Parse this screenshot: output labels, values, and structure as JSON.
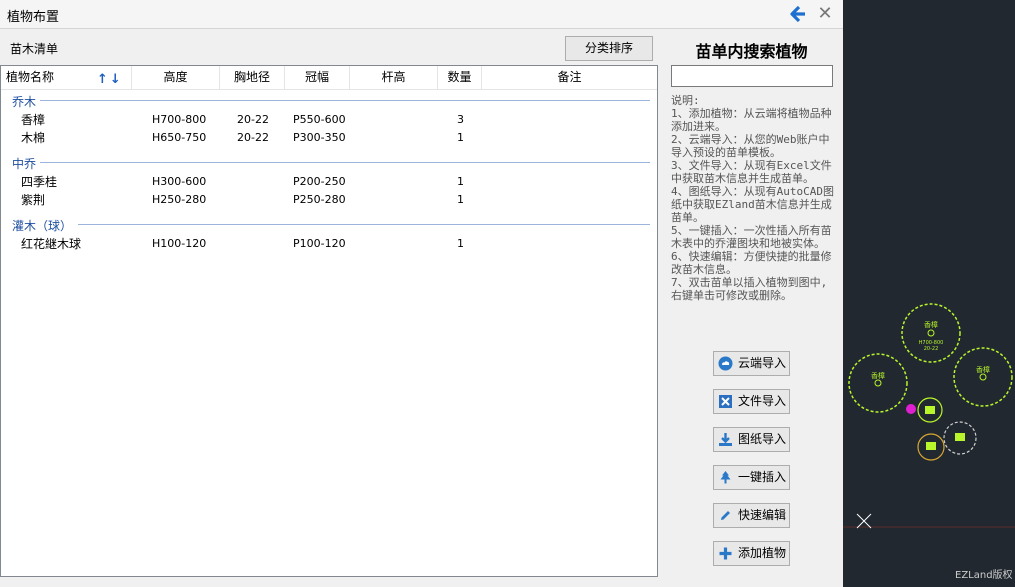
{
  "window": {
    "title": "植物布置"
  },
  "list_label": "苗木清单",
  "sort_button": "分类排序",
  "columns": [
    "植物名称",
    "高度",
    "胸地径",
    "冠幅",
    "杆高",
    "数量",
    "备注"
  ],
  "groups": [
    {
      "name": "乔木",
      "rows": [
        {
          "name": "香樟",
          "height": "H700-800",
          "dbh": "20-22",
          "crown": "P550-600",
          "pole": "",
          "qty": "3",
          "note": ""
        },
        {
          "name": "木棉",
          "height": "H650-750",
          "dbh": "20-22",
          "crown": "P300-350",
          "pole": "",
          "qty": "1",
          "note": ""
        }
      ]
    },
    {
      "name": "中乔",
      "rows": [
        {
          "name": "四季桂",
          "height": "H300-600",
          "dbh": "",
          "crown": "P200-250",
          "pole": "",
          "qty": "1",
          "note": ""
        },
        {
          "name": "紫荆",
          "height": "H250-280",
          "dbh": "",
          "crown": "P250-280",
          "pole": "",
          "qty": "1",
          "note": ""
        }
      ]
    },
    {
      "name": "灌木（球）",
      "rows": [
        {
          "name": "红花継木球",
          "height": "H100-120",
          "dbh": "",
          "crown": "P100-120",
          "pole": "",
          "qty": "1",
          "note": ""
        }
      ]
    }
  ],
  "search": {
    "title": "苗单内搜索植物",
    "value": ""
  },
  "instructions": [
    "说明:",
    "1、添加植物：从云端将植物品种添加进来。",
    "2、云端导入：从您的Web账户中导入预设的苗单模板。",
    "3、文件导入：从现有Excel文件中获取苗木信息并生成苗单。",
    "4、图纸导入：从现有AutoCAD图纸中获取EZland苗木信息并生成苗单。",
    "5、一键插入：一次性插入所有苗木表中的乔灌图块和地被实体。",
    "6、快速编辑：方便快捷的批量修改苗木信息。",
    "7、双击苗单以插入植物到图中,右键单击可修改或删除。"
  ],
  "actions": [
    {
      "label": "云端导入",
      "icon": "cloud-upload-icon"
    },
    {
      "label": "文件导入",
      "icon": "excel-icon"
    },
    {
      "label": "图纸导入",
      "icon": "download-icon"
    },
    {
      "label": "一键插入",
      "icon": "tree-icon"
    },
    {
      "label": "快速编辑",
      "icon": "pencil-icon"
    },
    {
      "label": "添加植物",
      "icon": "plus-icon"
    }
  ],
  "cad": {
    "copyright": "EZLand版权",
    "symbol_text": [
      "香樟",
      "H700-800",
      "20-22"
    ]
  },
  "colors": {
    "accent": "#1f6fd0",
    "group_text": "#1e4fa0",
    "cad_bg": "#212830",
    "cad_green": "#b8f52a"
  }
}
